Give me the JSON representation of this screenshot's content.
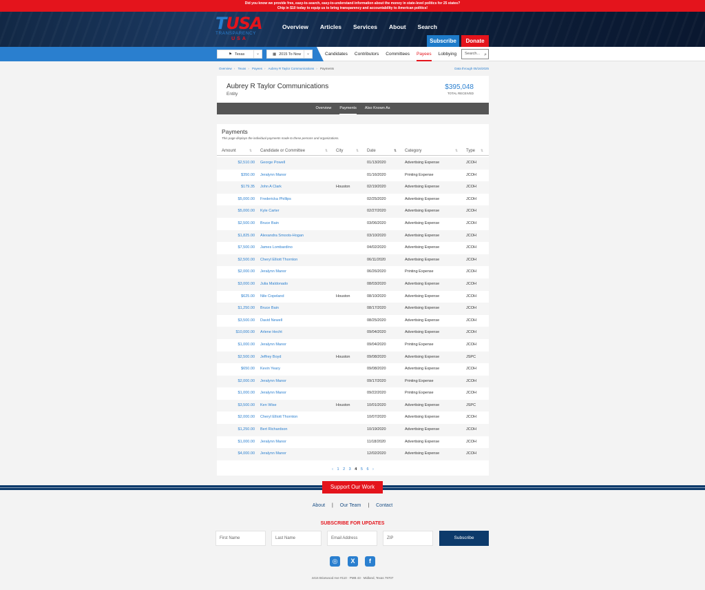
{
  "banner": {
    "line1": "Did you know we provide free, easy-to-search, easy-to-understand information about the money in state-level politics for 25 states?",
    "line2": "Chip in $10 today to equip us to bring transparency and accountability to American politics!"
  },
  "logo": {
    "big_t": "T",
    "big_usa": "USA",
    "sub1": "TRANSPARENCY",
    "sub2": "USA"
  },
  "topnav": [
    "Overview",
    "Articles",
    "Services",
    "About",
    "Search"
  ],
  "subscribe_label": "Subscribe",
  "donate_label": "Donate",
  "filters": {
    "state": "Texas",
    "period": "2015 To Now"
  },
  "subnav": {
    "tabs": [
      "Candidates",
      "Contributors",
      "Committees",
      "Payees",
      "Lobbying"
    ],
    "active": "Payees",
    "search_placeholder": "Search..."
  },
  "breadcrumbs": [
    "Overview",
    "Texas",
    "Payees",
    "Aubrey R Taylor Communications",
    "Payments"
  ],
  "data_through": "Data through 05/16/2025",
  "entity": {
    "name": "Aubrey R Taylor Communications",
    "type": "Entity",
    "total": "$395,048",
    "total_label": "TOTAL RECEIVED"
  },
  "entity_tabs": [
    "Overview",
    "Payments",
    "Also Known As"
  ],
  "payments": {
    "title": "Payments",
    "description": "This page displays the individual payments made to these persons and organizations.",
    "columns": [
      "Amount",
      "Candidate or Committee",
      "City",
      "Date",
      "Category",
      "Type"
    ],
    "rows": [
      {
        "amount": "$2,510.00",
        "cand": "George Powell",
        "city": "",
        "date": "01/13/2020",
        "cat": "Advertising Expense",
        "type": "JCOH"
      },
      {
        "amount": "$350.00",
        "cand": "Jeralynn Manor",
        "city": "",
        "date": "01/16/2020",
        "cat": "Printing Expense",
        "type": "JCOH"
      },
      {
        "amount": "$179.35",
        "cand": "John A Clark",
        "city": "Houston",
        "date": "02/19/2020",
        "cat": "Advertising Expense",
        "type": "JCOH"
      },
      {
        "amount": "$5,000.00",
        "cand": "Fredericka Phillips",
        "city": "",
        "date": "02/25/2020",
        "cat": "Advertising Expense",
        "type": "JCOH"
      },
      {
        "amount": "$5,000.00",
        "cand": "Kyle Carter",
        "city": "",
        "date": "02/27/2020",
        "cat": "Advertising Expense",
        "type": "JCOH"
      },
      {
        "amount": "$2,500.00",
        "cand": "Bruce Bain",
        "city": "",
        "date": "03/06/2020",
        "cat": "Advertising Expense",
        "type": "JCOH"
      },
      {
        "amount": "$1,825.00",
        "cand": "Alexandra Smoots-Hogan",
        "city": "",
        "date": "03/10/2020",
        "cat": "Advertising Expense",
        "type": "JCOH"
      },
      {
        "amount": "$7,500.00",
        "cand": "James Lombardino",
        "city": "",
        "date": "04/02/2020",
        "cat": "Advertising Expense",
        "type": "JCOH"
      },
      {
        "amount": "$2,500.00",
        "cand": "Cheryl Elliott Thornton",
        "city": "",
        "date": "06/11/2020",
        "cat": "Advertising Expense",
        "type": "JCOH"
      },
      {
        "amount": "$2,000.00",
        "cand": "Jeralynn Manor",
        "city": "",
        "date": "06/26/2020",
        "cat": "Printing Expense",
        "type": "JCOH"
      },
      {
        "amount": "$3,000.00",
        "cand": "Julia Maldonado",
        "city": "",
        "date": "08/03/2020",
        "cat": "Advertising Expense",
        "type": "JCOH"
      },
      {
        "amount": "$625.00",
        "cand": "Nile Copeland",
        "city": "Houston",
        "date": "08/10/2020",
        "cat": "Advertising Expense",
        "type": "JCOH"
      },
      {
        "amount": "$1,250.00",
        "cand": "Bruce Bain",
        "city": "",
        "date": "08/17/2020",
        "cat": "Advertising Expense",
        "type": "JCOH"
      },
      {
        "amount": "$3,500.00",
        "cand": "David Newell",
        "city": "",
        "date": "08/25/2020",
        "cat": "Advertising Expense",
        "type": "JCOH"
      },
      {
        "amount": "$10,000.00",
        "cand": "Arlene Hecht",
        "city": "",
        "date": "09/04/2020",
        "cat": "Advertising Expense",
        "type": "JCOH"
      },
      {
        "amount": "$1,000.00",
        "cand": "Jeralynn Manor",
        "city": "",
        "date": "09/04/2020",
        "cat": "Printing Expense",
        "type": "JCOH"
      },
      {
        "amount": "$2,500.00",
        "cand": "Jeffrey Boyd",
        "city": "Houston",
        "date": "09/08/2020",
        "cat": "Advertising Expense",
        "type": "JSPC"
      },
      {
        "amount": "$650.00",
        "cand": "Kevin Yeary",
        "city": "",
        "date": "09/08/2020",
        "cat": "Advertising Expense",
        "type": "JCOH"
      },
      {
        "amount": "$2,000.00",
        "cand": "Jeralynn Manor",
        "city": "",
        "date": "09/17/2020",
        "cat": "Printing Expense",
        "type": "JCOH"
      },
      {
        "amount": "$1,000.00",
        "cand": "Jeralynn Manor",
        "city": "",
        "date": "09/22/2020",
        "cat": "Printing Expense",
        "type": "JCOH"
      },
      {
        "amount": "$3,500.00",
        "cand": "Ken Wise",
        "city": "Houston",
        "date": "10/01/2020",
        "cat": "Advertising Expense",
        "type": "JSPC"
      },
      {
        "amount": "$2,000.00",
        "cand": "Cheryl Elliott Thornton",
        "city": "",
        "date": "10/07/2020",
        "cat": "Advertising Expense",
        "type": "JCOH"
      },
      {
        "amount": "$1,250.00",
        "cand": "Bert Richardson",
        "city": "",
        "date": "10/19/2020",
        "cat": "Advertising Expense",
        "type": "JCOH"
      },
      {
        "amount": "$1,000.00",
        "cand": "Jeralynn Manor",
        "city": "",
        "date": "11/18/2020",
        "cat": "Advertising Expense",
        "type": "JCOH"
      },
      {
        "amount": "$4,000.00",
        "cand": "Jeralynn Manor",
        "city": "",
        "date": "12/02/2020",
        "cat": "Advertising Expense",
        "type": "JCOH"
      }
    ],
    "pagination": {
      "prev": "‹",
      "pages": [
        "1",
        "2",
        "3",
        "4",
        "5",
        "6"
      ],
      "current": "4",
      "next": "›"
    }
  },
  "footer": {
    "support_label": "Support Our Work",
    "links": [
      "About",
      "Our Team",
      "Contact"
    ],
    "subscribe_heading": "SUBSCRIBE FOR UPDATES",
    "first_name": "First Name",
    "last_name": "Last Name",
    "email": "Email Address",
    "zip": "ZIP",
    "subscribe_button": "Subscribe",
    "address": "4416 Briarwood Ave #110  ·  PMB 43  ·  Midland, Texas 79707"
  },
  "icons": {
    "instagram": "instagram-icon",
    "x": "x-icon",
    "facebook": "facebook-icon"
  },
  "colors": {
    "brand_red": "#e4141c",
    "brand_blue": "#2a7fcf",
    "navy": "#0d3a6b"
  }
}
